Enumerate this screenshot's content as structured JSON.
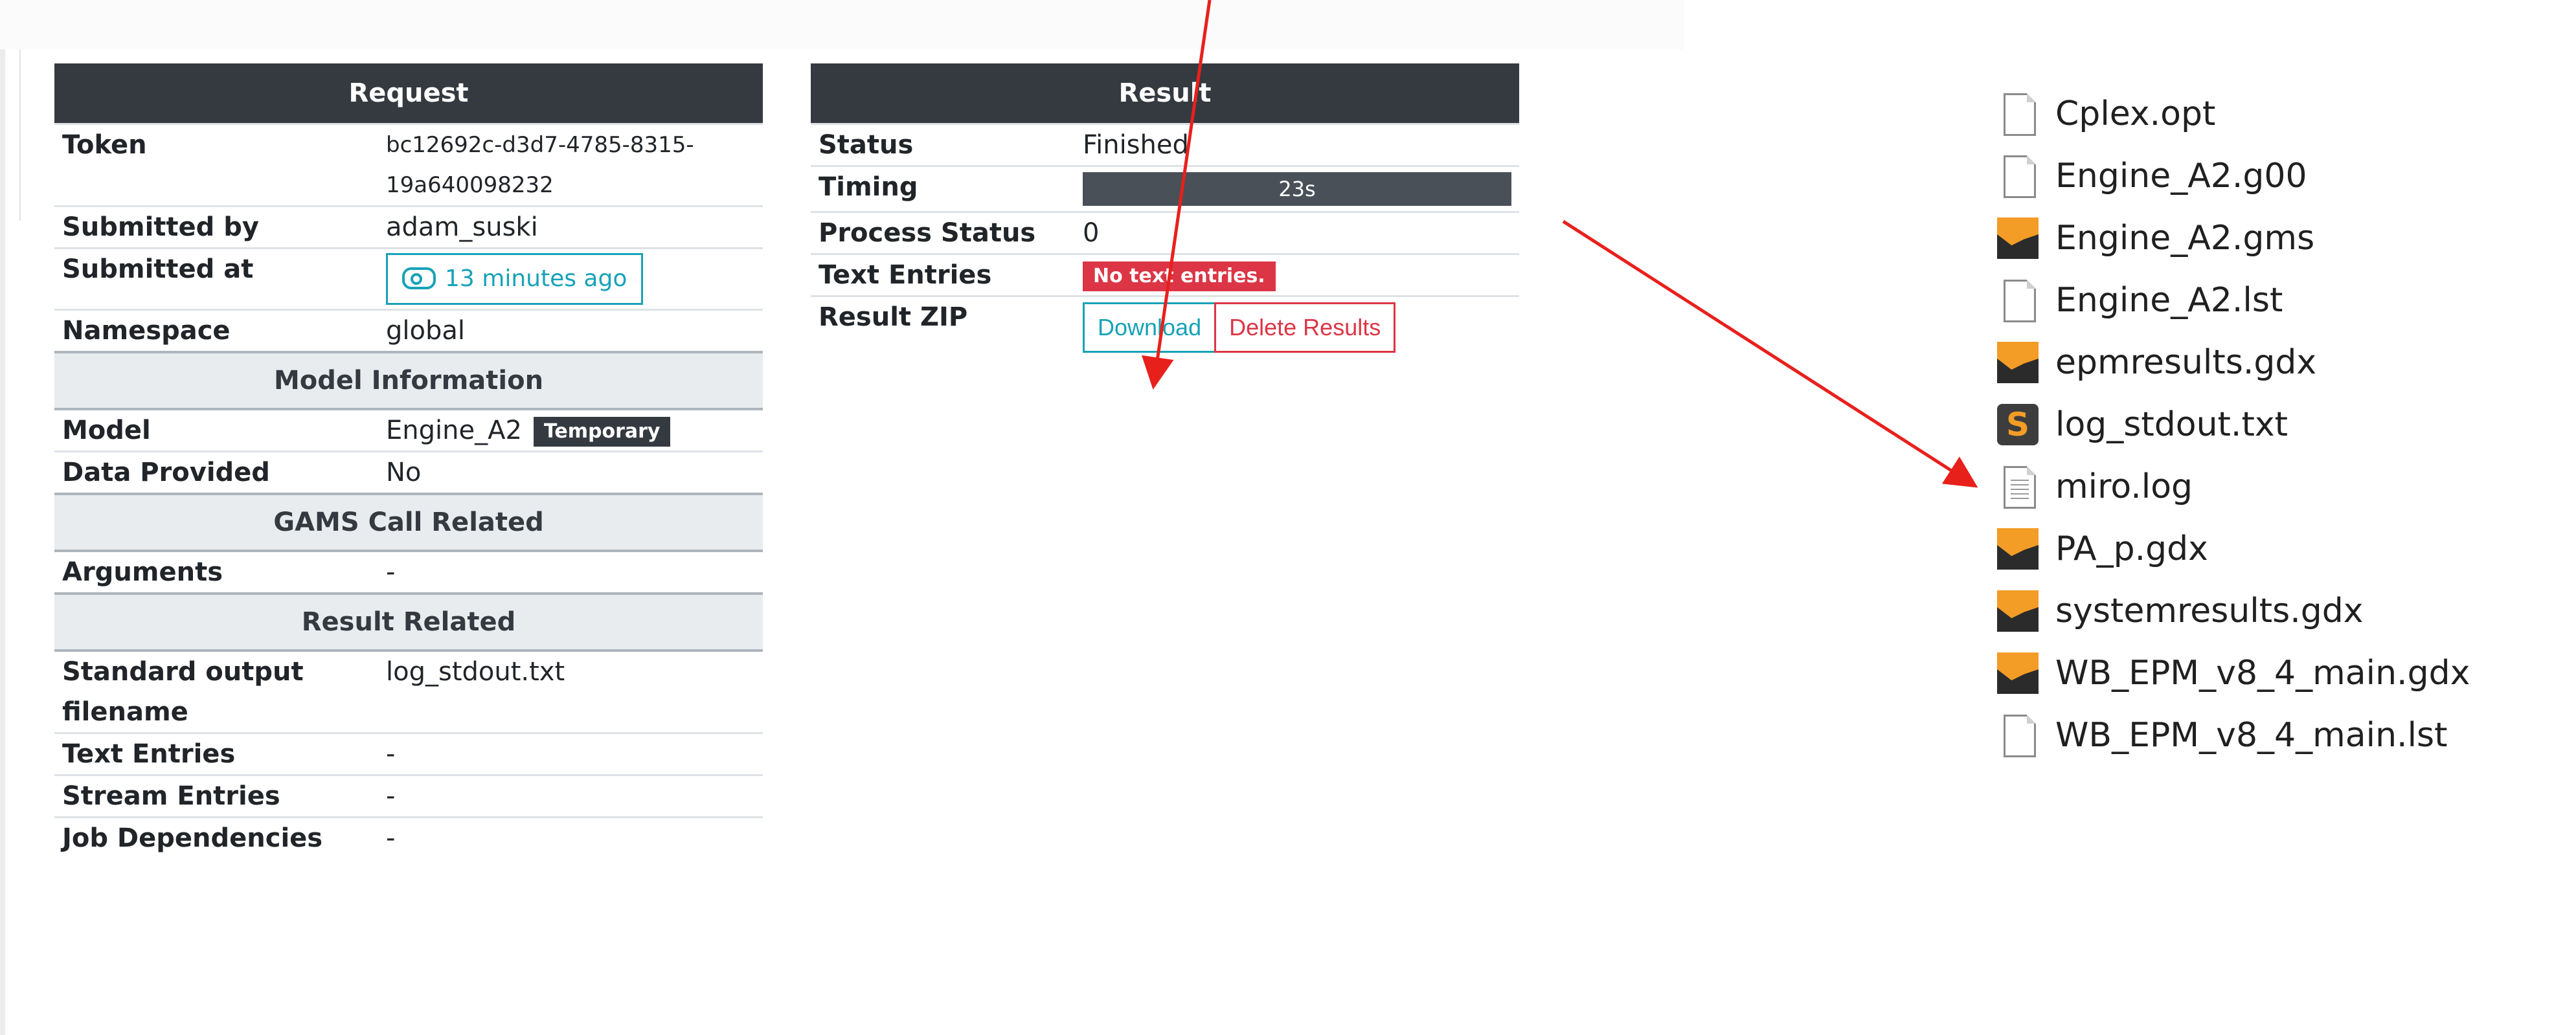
{
  "request": {
    "header": "Request",
    "token_label": "Token",
    "token_line1": "bc12692c-d3d7-4785-8315-",
    "token_line2": "19a640098232",
    "submitted_by_label": "Submitted by",
    "submitted_by": "adam_suski",
    "submitted_at_label": "Submitted at",
    "submitted_at": "13 minutes ago",
    "namespace_label": "Namespace",
    "namespace": "global",
    "model_section": "Model Information",
    "model_label": "Model",
    "model": "Engine_A2",
    "model_badge": "Temporary",
    "data_provided_label": "Data Provided",
    "data_provided": "No",
    "gams_section": "GAMS Call Related",
    "arguments_label": "Arguments",
    "arguments": "-",
    "result_section": "Result Related",
    "stdout_label_1": "Standard output",
    "stdout_label_2": "filename",
    "stdout": "log_stdout.txt",
    "text_entries_label": "Text Entries",
    "text_entries": "-",
    "stream_entries_label": "Stream Entries",
    "stream_entries": "-",
    "job_dependencies_label": "Job Dependencies",
    "job_dependencies": "-"
  },
  "result": {
    "header": "Result",
    "status_label": "Status",
    "status": "Finished",
    "timing_label": "Timing",
    "timing": "23s",
    "process_status_label": "Process Status",
    "process_status": "0",
    "text_entries_label": "Text Entries",
    "text_entries_badge": "No text entries.",
    "zip_label": "Result ZIP",
    "download_label": "Download",
    "delete_label": "Delete Results"
  },
  "files": [
    {
      "name": "Cplex.opt",
      "icon": "blank-file-icon"
    },
    {
      "name": "Engine_A2.g00",
      "icon": "blank-file-icon"
    },
    {
      "name": "Engine_A2.gms",
      "icon": "gams-file-icon"
    },
    {
      "name": "Engine_A2.lst",
      "icon": "blank-file-icon"
    },
    {
      "name": "epmresults.gdx",
      "icon": "gams-file-icon"
    },
    {
      "name": "log_stdout.txt",
      "icon": "sublime-text-icon"
    },
    {
      "name": "miro.log",
      "icon": "text-file-icon"
    },
    {
      "name": "PA_p.gdx",
      "icon": "gams-file-icon"
    },
    {
      "name": "systemresults.gdx",
      "icon": "gams-file-icon"
    },
    {
      "name": "WB_EPM_v8_4_main.gdx",
      "icon": "gams-file-icon"
    },
    {
      "name": "WB_EPM_v8_4_main.lst",
      "icon": "blank-file-icon"
    }
  ],
  "colors": {
    "header_bg": "#343a40",
    "info": "#17a2b8",
    "danger": "#dc3545",
    "annotation": "#e8201c",
    "gams_orange": "#f39c26"
  }
}
